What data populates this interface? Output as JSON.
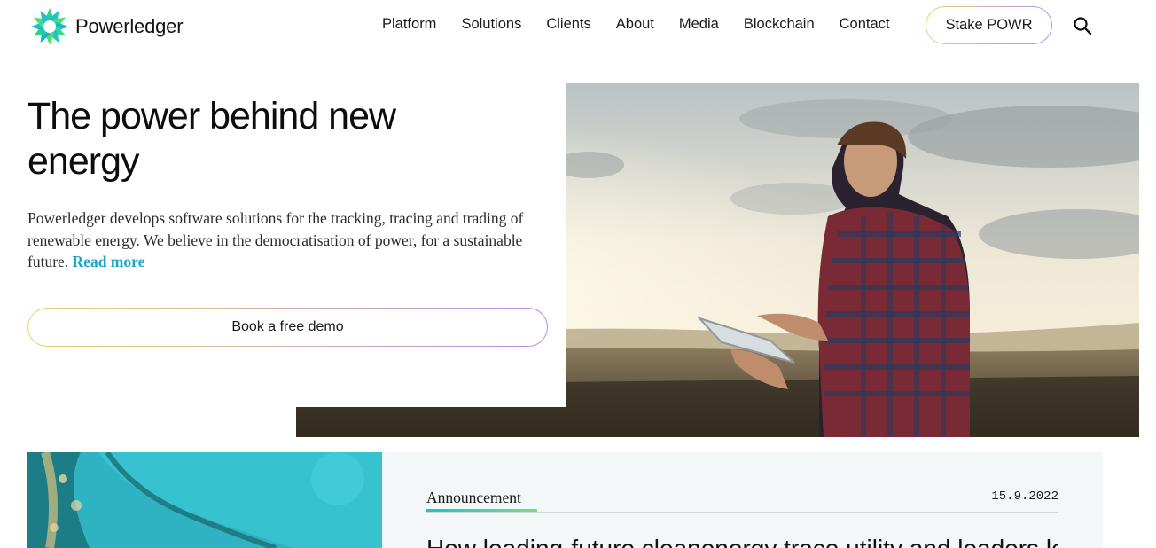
{
  "brand": {
    "name": "Powerledger"
  },
  "nav": {
    "items": [
      "Platform",
      "Solutions",
      "Clients",
      "About",
      "Media",
      "Blockchain",
      "Contact"
    ],
    "stake_label": "Stake POWR",
    "search_icon": "search-icon"
  },
  "hero": {
    "title": "The power behind new energy",
    "description": "Powerledger develops software solutions for the tracking, tracing and trading of renewable energy. We believe in the democratisation of power, for a sustainable future.",
    "read_more": "Read more",
    "demo_label": "Book a free demo"
  },
  "news": {
    "tag": "Announcement",
    "date": "15.9.2022",
    "headline": "How leading-future cleanenergy trace utility and leaders lead"
  },
  "colors": {
    "accent_link": "#1aa7c7",
    "button_border_start": "#e8d36a",
    "button_border_end": "#b98de6",
    "tag_underline_start": "#1cc4c9",
    "tag_underline_end": "#6fe08a",
    "news_panel": "#f4f7f7"
  }
}
